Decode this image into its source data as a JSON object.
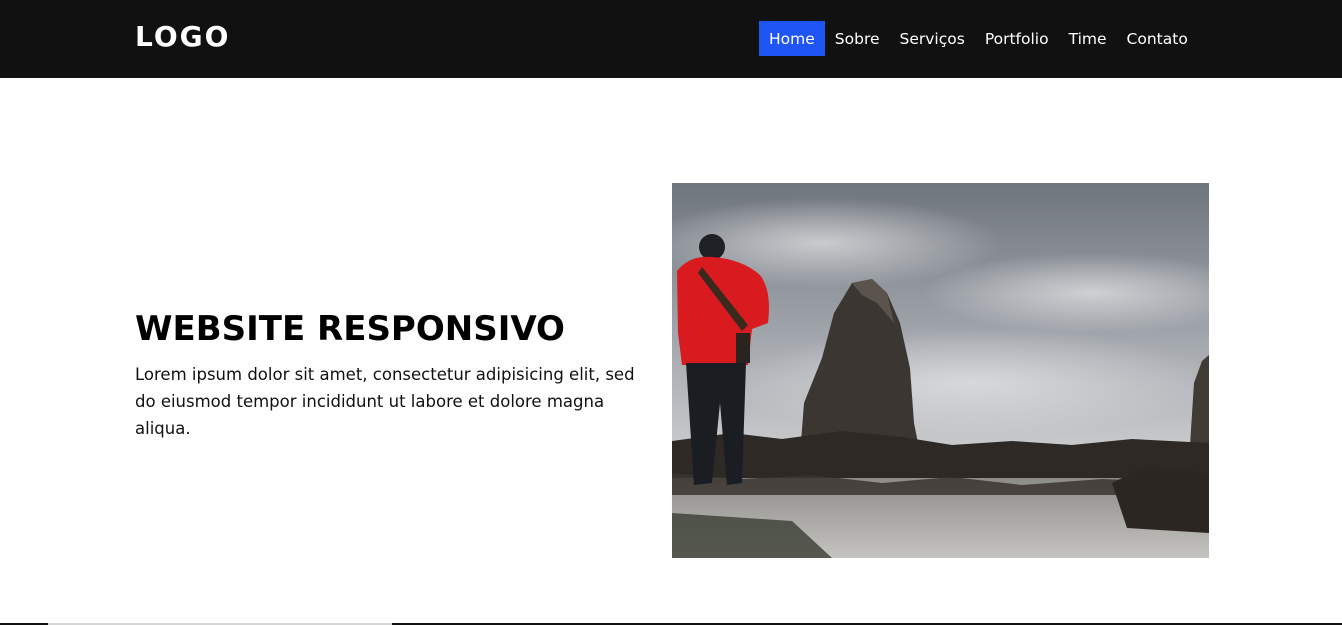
{
  "header": {
    "logo": "LOGO",
    "nav": [
      {
        "label": "Home",
        "active": true
      },
      {
        "label": "Sobre",
        "active": false
      },
      {
        "label": "Serviços",
        "active": false
      },
      {
        "label": "Portfolio",
        "active": false
      },
      {
        "label": "Time",
        "active": false
      },
      {
        "label": "Contato",
        "active": false
      }
    ]
  },
  "hero": {
    "title": "WEBSITE RESPONSIVO",
    "text": "Lorem ipsum dolor sit amet, consectetur adipisicing elit, sed do eiusmod tempor incididunt ut labore et dolore magna aliqua.",
    "image_icon": "landscape-photo"
  },
  "colors": {
    "navbar_bg": "#111111",
    "active_nav_bg": "#1f55f5",
    "text": "#000000",
    "jacket": "#d91a1f"
  }
}
